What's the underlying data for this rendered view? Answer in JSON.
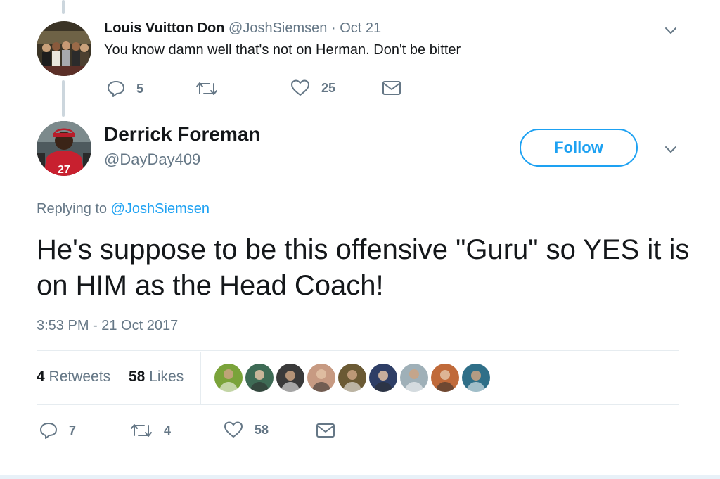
{
  "reply_tweet": {
    "display_name": "Louis Vuitton Don",
    "handle": "@JoshSiemsen",
    "separator": "·",
    "date": "Oct 21",
    "text": "You know damn well that's not on Herman. Don't be bitter",
    "replies": "5",
    "retweets": "",
    "likes": "25",
    "avatar_icon": "group-photo-avatar"
  },
  "main_tweet": {
    "display_name": "Derrick Foreman",
    "handle": "@DayDay409",
    "follow_label": "Follow",
    "replying_prefix": "Replying to",
    "replying_handle": "@JoshSiemsen",
    "text": "He's suppose to be this offensive \"Guru\" so YES it is on HIM as the Head Coach!",
    "timestamp": "3:53 PM - 21 Oct 2017",
    "retweet_count": "4",
    "retweet_label": "Retweets",
    "like_count": "58",
    "like_label": "Likes",
    "actions": {
      "replies": "7",
      "retweets": "4",
      "likes": "58"
    },
    "avatar_icon": "football-jersey-avatar"
  },
  "liker_avatars": [
    {
      "icon": "football-avatar",
      "bg": "#7aa33a"
    },
    {
      "icon": "character-avatar",
      "bg": "#3e6b55"
    },
    {
      "icon": "person-avatar",
      "bg": "#3a3a3a"
    },
    {
      "icon": "face-avatar",
      "bg": "#c79a82"
    },
    {
      "icon": "group-avatar",
      "bg": "#6b5a34"
    },
    {
      "icon": "flag-avatar",
      "bg": "#2e3e66"
    },
    {
      "icon": "face-avatar",
      "bg": "#9fb0b8"
    },
    {
      "icon": "sunset-avatar",
      "bg": "#c06a3a"
    },
    {
      "icon": "landscape-avatar",
      "bg": "#2f6f88"
    }
  ],
  "colors": {
    "accent": "#1da1f2",
    "muted_text": "#657786",
    "text": "#14171a",
    "border": "#e6ecf0",
    "thread_line": "#ccd6dd"
  }
}
